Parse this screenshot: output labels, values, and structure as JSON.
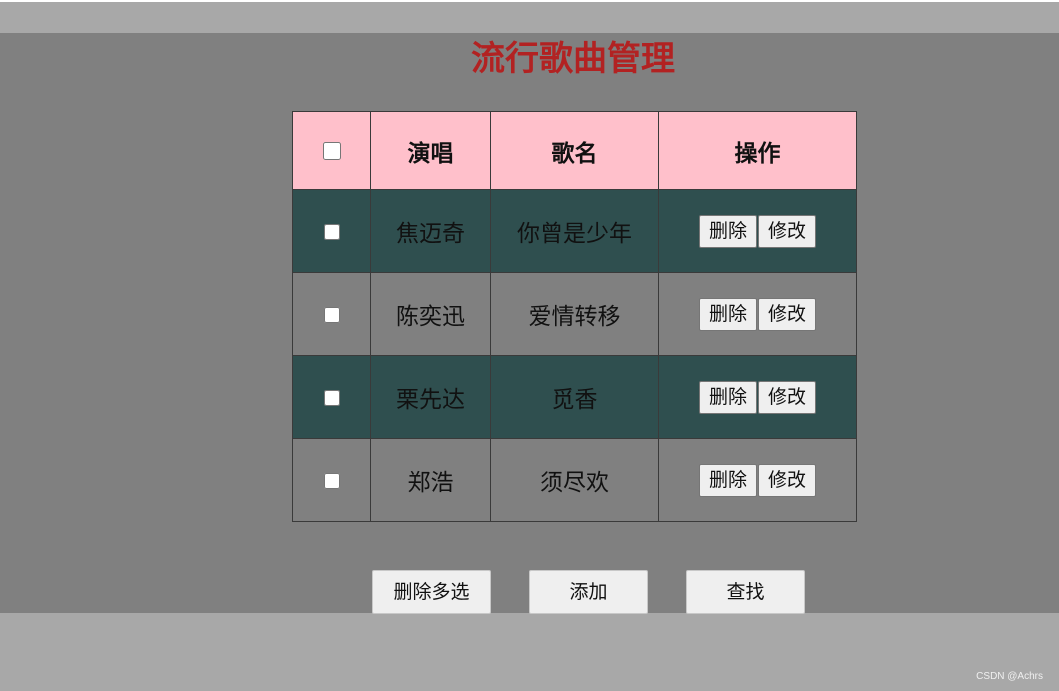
{
  "page": {
    "title": "流行歌曲管理"
  },
  "table": {
    "headers": {
      "singer": "演唱",
      "song": "歌名",
      "action": "操作"
    },
    "rows": [
      {
        "singer": "焦迈奇",
        "song": "你曾是少年",
        "delete": "删除",
        "edit": "修改",
        "checked": false
      },
      {
        "singer": "陈奕迅",
        "song": "爱情转移",
        "delete": "删除",
        "edit": "修改",
        "checked": false
      },
      {
        "singer": "栗先达",
        "song": "觅香",
        "delete": "删除",
        "edit": "修改",
        "checked": false
      },
      {
        "singer": "郑浩",
        "song": "须尽欢",
        "delete": "删除",
        "edit": "修改",
        "checked": false
      }
    ]
  },
  "buttons": {
    "delete_multi": "删除多选",
    "add": "添加",
    "find": "查找"
  },
  "watermark": "CSDN @Achrs",
  "colors": {
    "title": "#b22222",
    "header_bg": "#ffc0cb",
    "row_dark": "#2f4f4f",
    "row_light": "#808080"
  }
}
